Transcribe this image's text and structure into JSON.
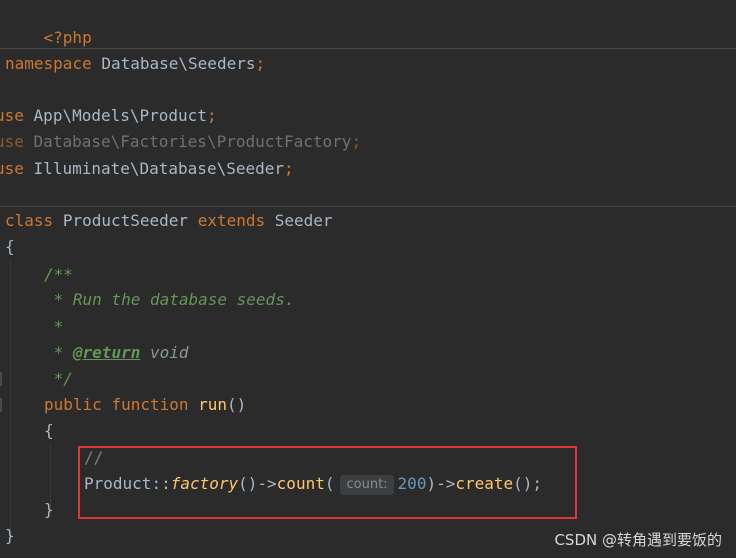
{
  "editor": {
    "lines": {
      "php_open": "<?php",
      "ns_kw": "namespace",
      "ns_name": "Database\\Seeders",
      "semicolon": ";",
      "use_kw": "use",
      "use1": "App\\Models\\Product",
      "use2": "Database\\Factories\\ProductFactory",
      "use3": "Illuminate\\Database\\Seeder",
      "class_kw": "class",
      "class_name": "ProductSeeder",
      "extends_kw": "extends",
      "parent_name": "Seeder",
      "open_brace": "{",
      "close_brace": "}",
      "doc_open": "/**",
      "doc_line1": " * Run the database seeds.",
      "doc_star": " *",
      "doc_star_prefix": " * ",
      "doc_return_tag": "@return",
      "doc_return_type": "void",
      "doc_close": " */",
      "public_kw": "public",
      "function_kw": "function",
      "method_name": "run",
      "method_parens": "()",
      "comment": "//",
      "call_class": "Product",
      "call_sep": "::",
      "call_factory": "factory",
      "call_parens": "()",
      "arrow": "->",
      "call_count": "count",
      "paren_open": "(",
      "hint_label": "count:",
      "count_value": "200",
      "paren_close": ")",
      "call_create": "create",
      "call_end": "();"
    }
  },
  "watermark": "CSDN @转角遇到要饭的",
  "colors": {
    "background": "#2b2b2b",
    "keyword": "#cc7832",
    "function": "#ffc66d",
    "number": "#6897bb",
    "doc_comment": "#629755",
    "highlight_border": "#e0363a"
  }
}
